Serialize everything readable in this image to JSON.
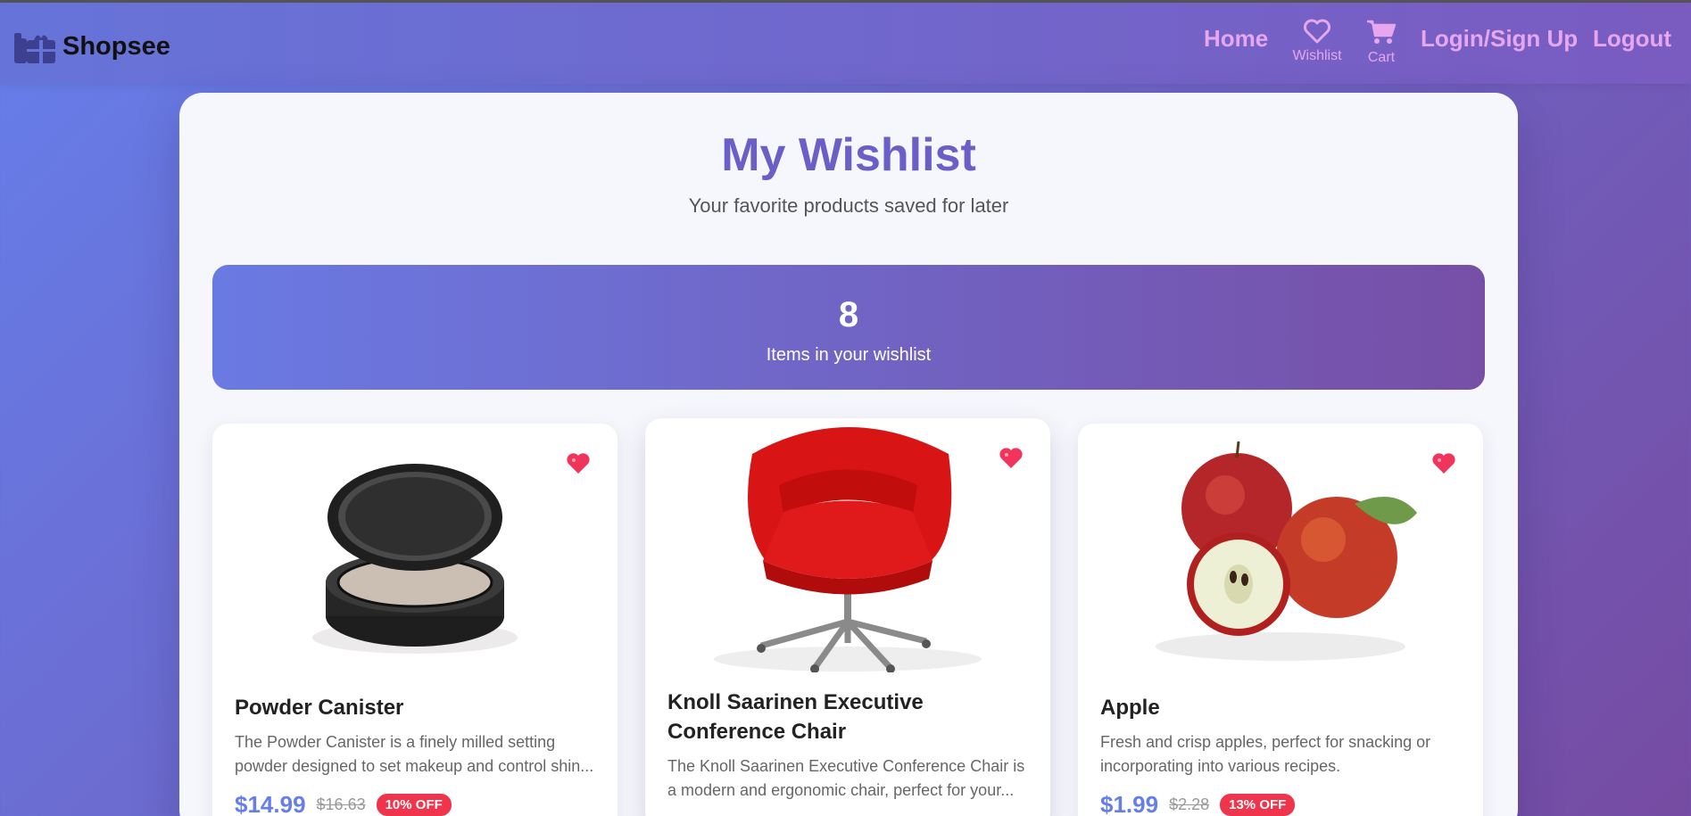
{
  "nav": {
    "brand": "Shopsee",
    "home": "Home",
    "wishlist_label": "Wishlist",
    "cart_label": "Cart",
    "login": "Login/Sign Up",
    "logout": "Logout"
  },
  "page": {
    "title": "My Wishlist",
    "subtitle": "Your favorite products saved for later"
  },
  "stats": {
    "count": "8",
    "label": "Items in your wishlist"
  },
  "products": [
    {
      "name": "Powder Canister",
      "description": "The Powder Canister is a finely milled setting powder designed to set makeup and control shin...",
      "price": "$14.99",
      "old_price": "$16.63",
      "discount": "10% OFF",
      "image": "powder-canister-image"
    },
    {
      "name": "Knoll Saarinen Executive Conference Chair",
      "description": "The Knoll Saarinen Executive Conference Chair is a modern and ergonomic chair, perfect for your...",
      "image": "red-chair-image"
    },
    {
      "name": "Apple",
      "description": "Fresh and crisp apples, perfect for snacking or incorporating into various recipes.",
      "price": "$1.99",
      "old_price": "$2.28",
      "discount": "13% OFF",
      "image": "apples-image"
    }
  ],
  "colors": {
    "accent": "#667eea",
    "accent_purple": "#764ba2",
    "nav_link": "#e7a6f0",
    "heart": "#f0345c",
    "discount_badge": "#f0344c"
  }
}
